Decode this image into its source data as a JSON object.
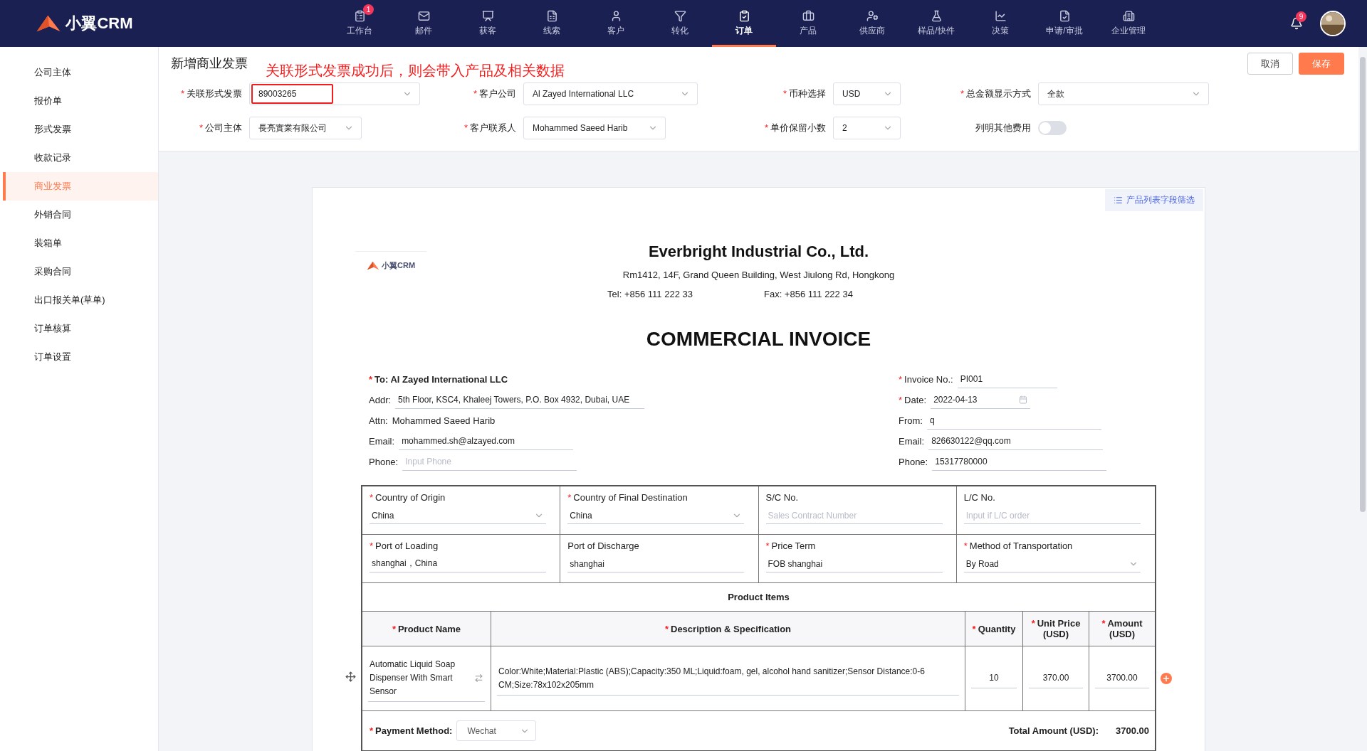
{
  "nav": {
    "logo_text": "小翼CRM",
    "items": [
      {
        "label": "工作台",
        "selected": false,
        "badge": "1"
      },
      {
        "label": "邮件",
        "selected": false
      },
      {
        "label": "获客",
        "selected": false
      },
      {
        "label": "线索",
        "selected": false
      },
      {
        "label": "客户",
        "selected": false
      },
      {
        "label": "转化",
        "selected": false
      },
      {
        "label": "订单",
        "selected": true
      },
      {
        "label": "产品",
        "selected": false
      },
      {
        "label": "供应商",
        "selected": false
      },
      {
        "label": "样品/快件",
        "selected": false
      },
      {
        "label": "决策",
        "selected": false
      },
      {
        "label": "申请/审批",
        "selected": false
      },
      {
        "label": "企业管理",
        "selected": false
      }
    ],
    "notification_badge": "9"
  },
  "sidebar": {
    "items": [
      {
        "label": "公司主体",
        "selected": false
      },
      {
        "label": "报价单",
        "selected": false
      },
      {
        "label": "形式发票",
        "selected": false
      },
      {
        "label": "收款记录",
        "selected": false
      },
      {
        "label": "商业发票",
        "selected": true
      },
      {
        "label": "外销合同",
        "selected": false
      },
      {
        "label": "装箱单",
        "selected": false
      },
      {
        "label": "采购合同",
        "selected": false
      },
      {
        "label": "出口报关单(草单)",
        "selected": false
      },
      {
        "label": "订单核算",
        "selected": false
      },
      {
        "label": "订单设置",
        "selected": false
      }
    ]
  },
  "header": {
    "title": "新增商业发票",
    "annotation": "关联形式发票成功后，则会带入产品及相关数据",
    "buttons": [
      {
        "label": "取消",
        "kind": "secondary"
      },
      {
        "label": "保存",
        "kind": "primary"
      }
    ]
  },
  "form": {
    "fields": [
      {
        "mark": "*",
        "label": "关联形式发票",
        "kind": "select",
        "value": "89003265",
        "highlighted": true
      },
      {
        "mark": "*",
        "label": "客户公司",
        "kind": "select",
        "value": "Al Zayed International LLC",
        "highlighted": false
      },
      {
        "mark": "*",
        "label": "币种选择",
        "kind": "select",
        "value": "USD",
        "highlighted": false
      },
      {
        "mark": "*",
        "label": "总金额显示方式",
        "kind": "select",
        "value": "全款",
        "highlighted": false
      },
      {
        "mark": "*",
        "label": "公司主体",
        "kind": "select",
        "value": "長亮實業有限公司",
        "highlighted": false
      },
      {
        "mark": "*",
        "label": "客户联系人",
        "kind": "select",
        "value": "Mohammed Saeed Harib",
        "highlighted": false
      },
      {
        "mark": "*",
        "label": "单价保留小数",
        "kind": "select",
        "value": "2",
        "highlighted": false
      },
      {
        "label": "列明其他费用",
        "kind": "toggle",
        "on": false
      }
    ]
  },
  "invoice": {
    "filter_link": "产品列表字段筛选",
    "logo_text": "小翼CRM",
    "company": "Everbright Industrial Co., Ltd.",
    "address": "Rm1412, 14F, Grand Queen Building, West Jiulong Rd, Hongkong",
    "tel": "Tel: +856 111 222 33",
    "fax": "Fax: +856 111 222 34",
    "title": "COMMERCIAL INVOICE",
    "to": {
      "mark": "*",
      "label": "To:",
      "value": "Al Zayed International LLC"
    },
    "buyer_fields": [
      {
        "label": "Addr:",
        "kind": "input",
        "value": "5th Floor, KSC4, Khaleej Towers, P.O. Box 4932, Dubai, UAE"
      },
      {
        "label": "Attn:",
        "kind": "text",
        "value": "Mohammed Saeed Harib"
      },
      {
        "label": "Email:",
        "kind": "input",
        "value": "mohammed.sh@alzayed.com"
      },
      {
        "label": "Phone:",
        "kind": "input",
        "placeholder": "Input Phone"
      }
    ],
    "seller_fields": [
      {
        "mark": "*",
        "label": "Invoice No.:",
        "kind": "input",
        "value": "PI001"
      },
      {
        "mark": "*",
        "label": "Date:",
        "kind": "date",
        "value": "2022-04-13"
      },
      {
        "label": "From:",
        "kind": "input",
        "value": "q"
      },
      {
        "label": "Email:",
        "kind": "input",
        "value": "826630122@qq.com"
      },
      {
        "label": "Phone:",
        "kind": "input",
        "value": "15317780000"
      }
    ],
    "shipping": [
      {
        "mark": "*",
        "label": "Country of Origin",
        "kind": "select",
        "value": "China"
      },
      {
        "mark": "*",
        "label": "Country of Final Destination",
        "kind": "select",
        "value": "China"
      },
      {
        "label": "S/C No.",
        "kind": "input",
        "placeholder": "Sales Contract Number"
      },
      {
        "label": "L/C No.",
        "kind": "input",
        "placeholder": "Input if L/C order"
      },
      {
        "mark": "*",
        "label": "Port of Loading",
        "kind": "input",
        "value": "shanghai，China"
      },
      {
        "label": "Port of Discharge",
        "kind": "input",
        "value": "shanghai"
      },
      {
        "mark": "*",
        "label": "Price Term",
        "kind": "input",
        "value": "FOB shanghai"
      },
      {
        "mark": "*",
        "label": "Method of Transportation",
        "kind": "select",
        "value": "By Road"
      }
    ],
    "product_items_title": "Product Items",
    "columns": [
      {
        "mark": "*",
        "label": "Product Name"
      },
      {
        "mark": "*",
        "label": "Description & Specification"
      },
      {
        "mark": "*",
        "label": "Quantity"
      },
      {
        "mark": "*",
        "label": "Unit Price (USD)"
      },
      {
        "mark": "*",
        "label": "Amount (USD)"
      }
    ],
    "rows": [
      {
        "product_name": "Automatic Liquid Soap Dispenser With Smart Sensor",
        "description": "Color:White;Material:Plastic (ABS);Capacity:350 ML;Liquid:foam, gel, alcohol hand sanitizer;Sensor Distance:0-6 CM;Size:78x102x205mm",
        "quantity": "10",
        "unit_price": "370.00",
        "amount": "3700.00"
      }
    ],
    "payment": {
      "mark": "*",
      "label": "Payment Method:",
      "value": "Wechat"
    },
    "total": {
      "label": "Total Amount (USD):",
      "value": "3700.00"
    }
  }
}
